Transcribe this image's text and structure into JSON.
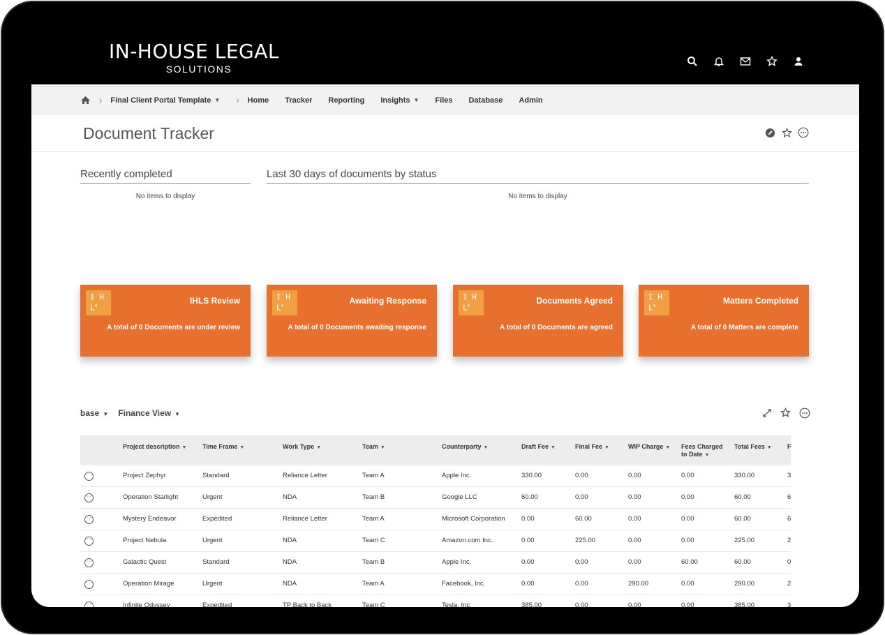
{
  "brand": {
    "name": "IN-HOUSE LEGAL",
    "sub": "SOLUTIONS"
  },
  "header_icons": [
    "search-icon",
    "bell-icon",
    "mail-icon",
    "star-icon",
    "user-icon"
  ],
  "breadcrumb": {
    "site": "Final Client Portal Template",
    "items": [
      "Home",
      "Tracker",
      "Reporting",
      "Insights",
      "Files",
      "Database",
      "Admin"
    ]
  },
  "page": {
    "title": "Document Tracker"
  },
  "webparts": {
    "recent": {
      "title": "Recently completed",
      "empty": "No items to display"
    },
    "status": {
      "title": "Last 30 days of documents by status",
      "empty": "No items to display"
    }
  },
  "tiles": [
    {
      "logo": "I H L s",
      "title": "IHLS Review",
      "desc": "A total of 0 Documents are under review"
    },
    {
      "logo": "I H L s",
      "title": "Awaiting Response",
      "desc": "A total of 0 Documents awaiting response"
    },
    {
      "logo": "I H L s",
      "title": "Documents Agreed",
      "desc": "A total of 0 Documents are agreed"
    },
    {
      "logo": "I H L s",
      "title": "Matters Completed",
      "desc": "A total of 0 Matters are complete"
    }
  ],
  "view_bar": {
    "base_label": "base",
    "view_label": "Finance View"
  },
  "grid": {
    "columns": [
      "Project description",
      "Time Frame",
      "Work Type",
      "Team",
      "Counterparty",
      "Draft Fee",
      "Final Fee",
      "WIP Charge",
      "Fees Charged to Date",
      "Total Fees",
      "F"
    ],
    "rows": [
      [
        "Project Zephyr",
        "Standard",
        "Reliance Letter",
        "Team A",
        "Apple Inc.",
        "330.00",
        "0.00",
        "0.00",
        "0.00",
        "330.00",
        "3"
      ],
      [
        "Operation Starlight",
        "Urgent",
        "NDA",
        "Team B",
        "Google LLC",
        "60.00",
        "0.00",
        "0.00",
        "0.00",
        "60.00",
        "6"
      ],
      [
        "Mystery Endeavor",
        "Expedited",
        "Reliance Letter",
        "Team A",
        "Microsoft Corporation",
        "0.00",
        "60.00",
        "0.00",
        "0.00",
        "60.00",
        "6"
      ],
      [
        "Project Nebula",
        "Urgent",
        "NDA",
        "Team C",
        "Amazon.com Inc.",
        "0.00",
        "225.00",
        "0.00",
        "0.00",
        "225.00",
        "2"
      ],
      [
        "Galactic Quest",
        "Standard",
        "NDA",
        "Team B",
        "Apple Inc.",
        "0.00",
        "0.00",
        "0.00",
        "60.00",
        "60.00",
        "0"
      ],
      [
        "Operation Mirage",
        "Urgent",
        "NDA",
        "Team A",
        "Facebook, Inc.",
        "0.00",
        "0.00",
        "290.00",
        "0.00",
        "290.00",
        "2"
      ],
      [
        "Infinite Odyssey",
        "Expedited",
        "TP Back to Back",
        "Team C",
        "Tesla, Inc.",
        "385.00",
        "0.00",
        "0.00",
        "0.00",
        "385.00",
        "3"
      ]
    ]
  },
  "colors": {
    "accent": "#e8702e",
    "tile_logo": "#f0a043",
    "header": "#000000"
  }
}
